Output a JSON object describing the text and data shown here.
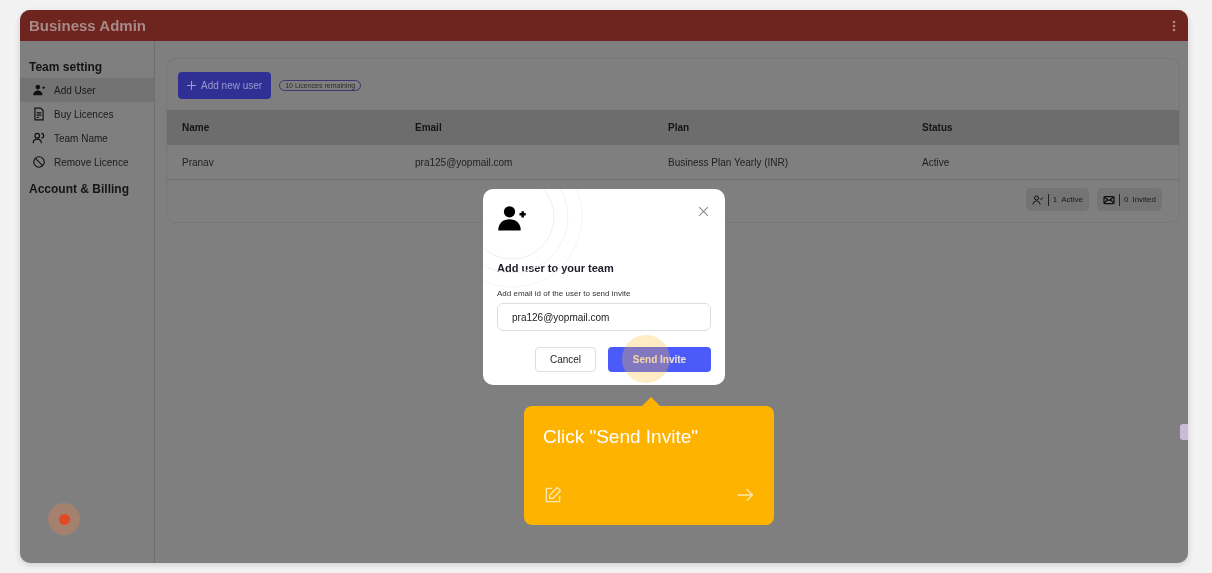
{
  "window": {
    "title": "Business Admin"
  },
  "sidebar": {
    "sections": [
      {
        "title": "Team setting",
        "items": [
          {
            "label": "Add User",
            "selected": true
          },
          {
            "label": "Buy Licences",
            "selected": false
          },
          {
            "label": "Team Name",
            "selected": false
          },
          {
            "label": "Remove Licence",
            "selected": false
          }
        ]
      },
      {
        "title": "Account & Billing"
      }
    ]
  },
  "toolbar": {
    "add_button": "Add new user",
    "badge": "10 Licences remaining"
  },
  "table": {
    "columns": [
      "Name",
      "Email",
      "Plan",
      "Status"
    ],
    "rows": [
      [
        "Pranav",
        "pra125@yopmail.com",
        "Business Plan Yearly (INR)",
        "Active"
      ]
    ]
  },
  "stats": [
    {
      "kind": "active",
      "count": "1",
      "label": "Active"
    },
    {
      "kind": "invited",
      "count": "0",
      "label": "Invited"
    }
  ],
  "dialog": {
    "title": "Add user to your team",
    "field_label": "Add email id of the user to send invite",
    "value": "pra126@yopmail.com",
    "cancel": "Cancel",
    "submit": "Send Invite"
  },
  "guide": {
    "text": "Click \"Send Invite\""
  }
}
